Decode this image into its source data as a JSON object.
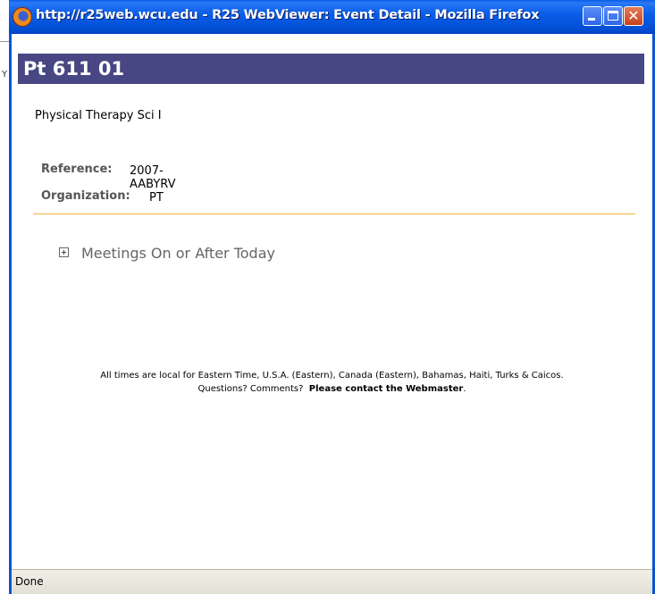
{
  "browser": {
    "window_title": "http://r25web.wcu.edu - R25 WebViewer: Event Detail - Mozilla Firefox",
    "status": "Done"
  },
  "event": {
    "code": "Pt 611 01",
    "name": "Physical Therapy Sci I",
    "reference_label": "Reference:",
    "reference_value": "2007-AABYRV",
    "organization_label": "Organization:",
    "organization_value": "PT"
  },
  "meetings": {
    "label": "Meetings On or After Today"
  },
  "footer": {
    "timezone_note": "All times are local for Eastern Time, U.S.A. (Eastern), Canada (Eastern), Bahamas, Haiti, Turks & Caicos.",
    "questions": "Questions? Comments?",
    "contact_link": "Please contact the Webmaster"
  },
  "colors": {
    "header_bg": "#474783",
    "divider": "#efb33c",
    "titlebar": "#0451d7"
  }
}
